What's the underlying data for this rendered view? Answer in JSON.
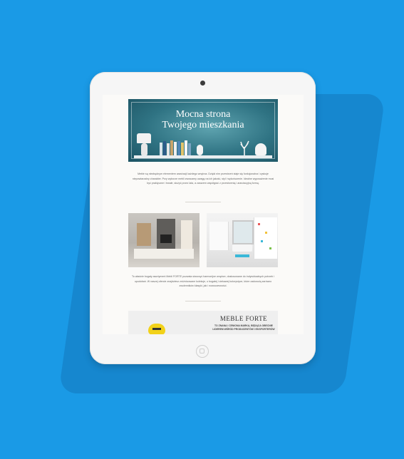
{
  "banner": {
    "title_line1": "Mocna strona",
    "title_line2": "Twojego mieszkania"
  },
  "intro_text": "Meble są niezbędnym elementem aranżacji każdego wnętrza. Dzięki nim przestrzeń staje się funkcjonalna i zyskuje niepowtarzalny charakter. Przy wyborze mebli zwracamy uwagę na ich jakość, styl i wykończenie. Idealne wyposażenie musi być praktyczne i trwałe, służyć przez lata, a zarazem współgrać z przestrzenią i aranżacyjną formą.",
  "mid_text": "To właśnie bogaty asortyment Mebli FORTE pozwala stworzyć harmonijne wnętrze, dostosowane do indywidualnych potrzeb i upodobań. W naszej ofercie znajdziesz zróżnicowane kolekcje, o bogatej i ciekawej kolorystyce, które zadowolą zarówno zwolenników klasyki, jak i nowoczesności.",
  "card": {
    "title": "MEBLE FORTE",
    "subtitle": "TO ZNANA I CENIONA MARKA, BĘDĄCA OBECNIE LIDEREM WŚRÓD PRODUCENTÓW I EKSPORTERÓW"
  },
  "colors": {
    "background": "#1a9ae6",
    "tablet": "#f6f6f6",
    "banner": "#2f7383",
    "accent_yellow": "#f2d21a"
  },
  "icons": {
    "camera": "camera-dot",
    "home_button": "home-button"
  }
}
